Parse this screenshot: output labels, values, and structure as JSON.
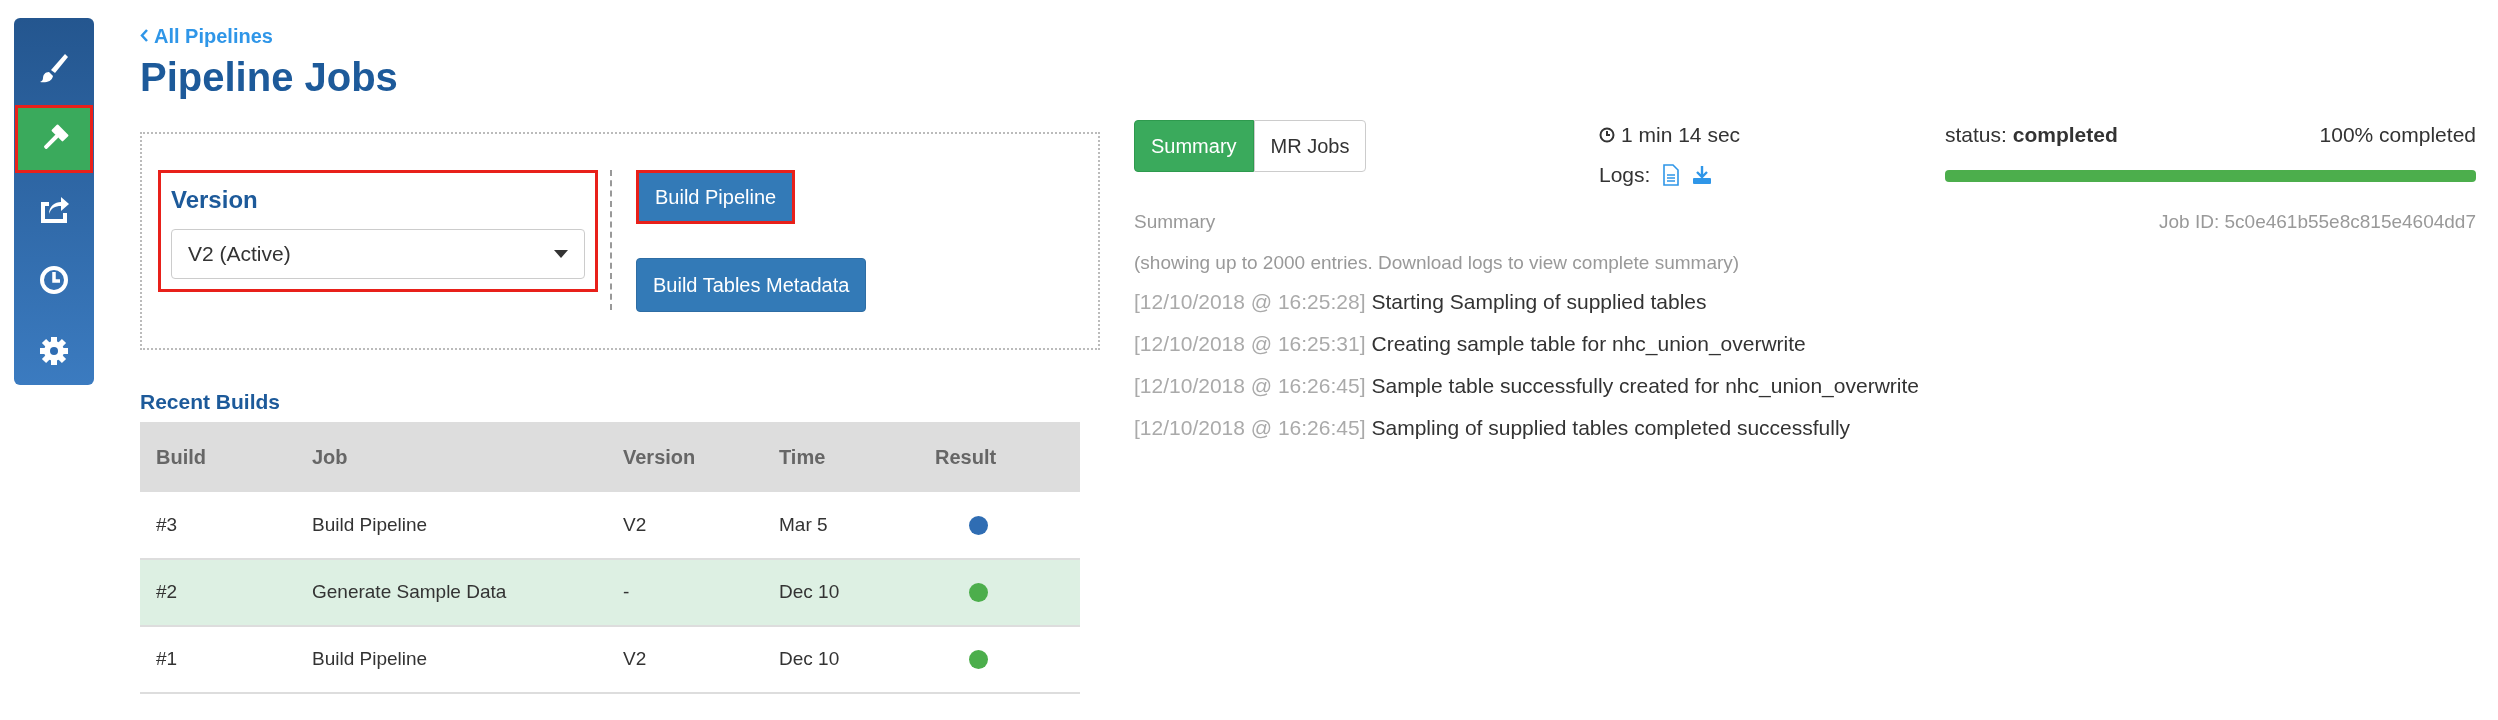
{
  "sidebar": {
    "items": [
      {
        "kind": "brush",
        "selected": false,
        "highlighted": false
      },
      {
        "kind": "gavel",
        "selected": true,
        "highlighted": true
      },
      {
        "kind": "share",
        "selected": false,
        "highlighted": false
      },
      {
        "kind": "clock",
        "selected": false,
        "highlighted": false
      },
      {
        "kind": "gear",
        "selected": false,
        "highlighted": false
      }
    ]
  },
  "back_link": "All Pipelines",
  "title": "Pipeline Jobs",
  "version_group": {
    "label": "Version",
    "value": "V2 (Active)",
    "highlighted": true
  },
  "buttons": [
    {
      "label": "Build Pipeline",
      "highlighted": true
    },
    {
      "label": "Build Tables Metadata",
      "highlighted": false
    }
  ],
  "recent_builds": {
    "title": "Recent Builds",
    "columns": [
      "Build",
      "Job",
      "Version",
      "Time",
      "Result"
    ],
    "rows": [
      {
        "build": "#3",
        "job": "Build Pipeline",
        "version": "V2",
        "time": "Mar 5",
        "color": "#2f6db3",
        "selected": false
      },
      {
        "build": "#2",
        "job": "Generate Sample Data",
        "version": "-",
        "time": "Dec 10",
        "color": "#4cae4c",
        "selected": true
      },
      {
        "build": "#1",
        "job": "Build Pipeline",
        "version": "V2",
        "time": "Dec 10",
        "color": "#4cae4c",
        "selected": false
      }
    ]
  },
  "tabs": [
    {
      "label": "Summary",
      "selected": true
    },
    {
      "label": "MR Jobs",
      "selected": false
    }
  ],
  "duration": "1 min 14 sec",
  "logs_label": "Logs:",
  "status_label": "status:",
  "status_value": "completed",
  "percent": "100% completed",
  "progress": {
    "level": 1
  },
  "summary": {
    "title": "Summary",
    "job_id": "Job ID: 5c0e461b55e8c815e4604dd7",
    "note": "(showing up to 2000 entries. Download logs to view complete summary)",
    "entries": [
      {
        "time": "[12/10/2018 @ 16:25:28]",
        "message": "Starting Sampling of supplied tables"
      },
      {
        "time": "[12/10/2018 @ 16:25:31]",
        "message": "Creating sample table for nhc_union_overwrite"
      },
      {
        "time": "[12/10/2018 @ 16:26:45]",
        "message": "Sample table successfully created for nhc_union_overwrite"
      },
      {
        "time": "[12/10/2018 @ 16:26:45]",
        "message": "Sampling of supplied tables completed successfully"
      }
    ]
  }
}
